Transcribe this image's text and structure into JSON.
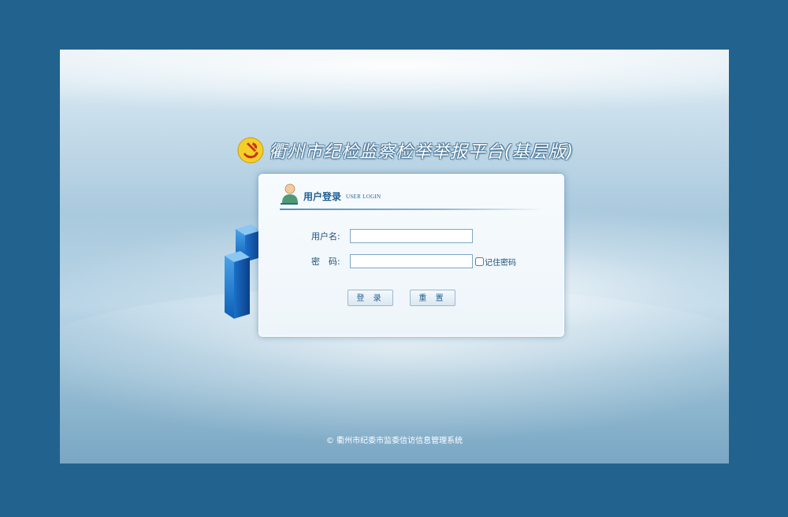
{
  "header": {
    "title": "衢州市纪检监察检举举报平台(基层版)",
    "emblem_icon": "party-emblem-icon"
  },
  "login": {
    "title": "用户登录",
    "subtitle": "USER LOGIN",
    "user_icon": "user-avatar-icon",
    "username_label": "用户名:",
    "username_value": "",
    "password_label": "密　码:",
    "password_value": "",
    "remember_label": "记住密码",
    "remember_checked": false,
    "login_button": "登 录",
    "reset_button": "重 置"
  },
  "footer": {
    "copyright": "© 衢州市纪委市监委信访信息管理系统"
  },
  "colors": {
    "outer_background": "#22628f",
    "accent_text": "#1f5f95",
    "emblem_gold": "#f2c21b"
  }
}
